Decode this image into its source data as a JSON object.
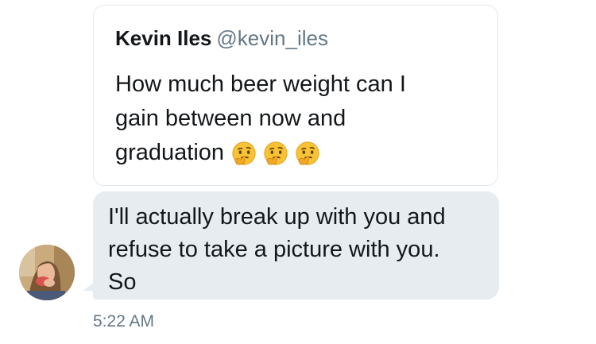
{
  "quoted_tweet": {
    "author_name": "Kevin Iles",
    "author_handle": "@kevin_iles",
    "text_line1": "How much beer weight can I",
    "text_line2": "gain between now and",
    "text_line3": "graduation",
    "emojis": [
      "thinking-face-icon",
      "thinking-face-icon",
      "thinking-face-icon"
    ]
  },
  "message": {
    "line1": "I'll actually break up with you and",
    "line2": "refuse to take a picture with you.",
    "line3": "So",
    "timestamp": "5:22 AM"
  },
  "colors": {
    "bubble_bg": "#e6ecf0",
    "text_primary": "#14171a",
    "text_secondary": "#657786",
    "card_border": "#e1e8ed"
  }
}
